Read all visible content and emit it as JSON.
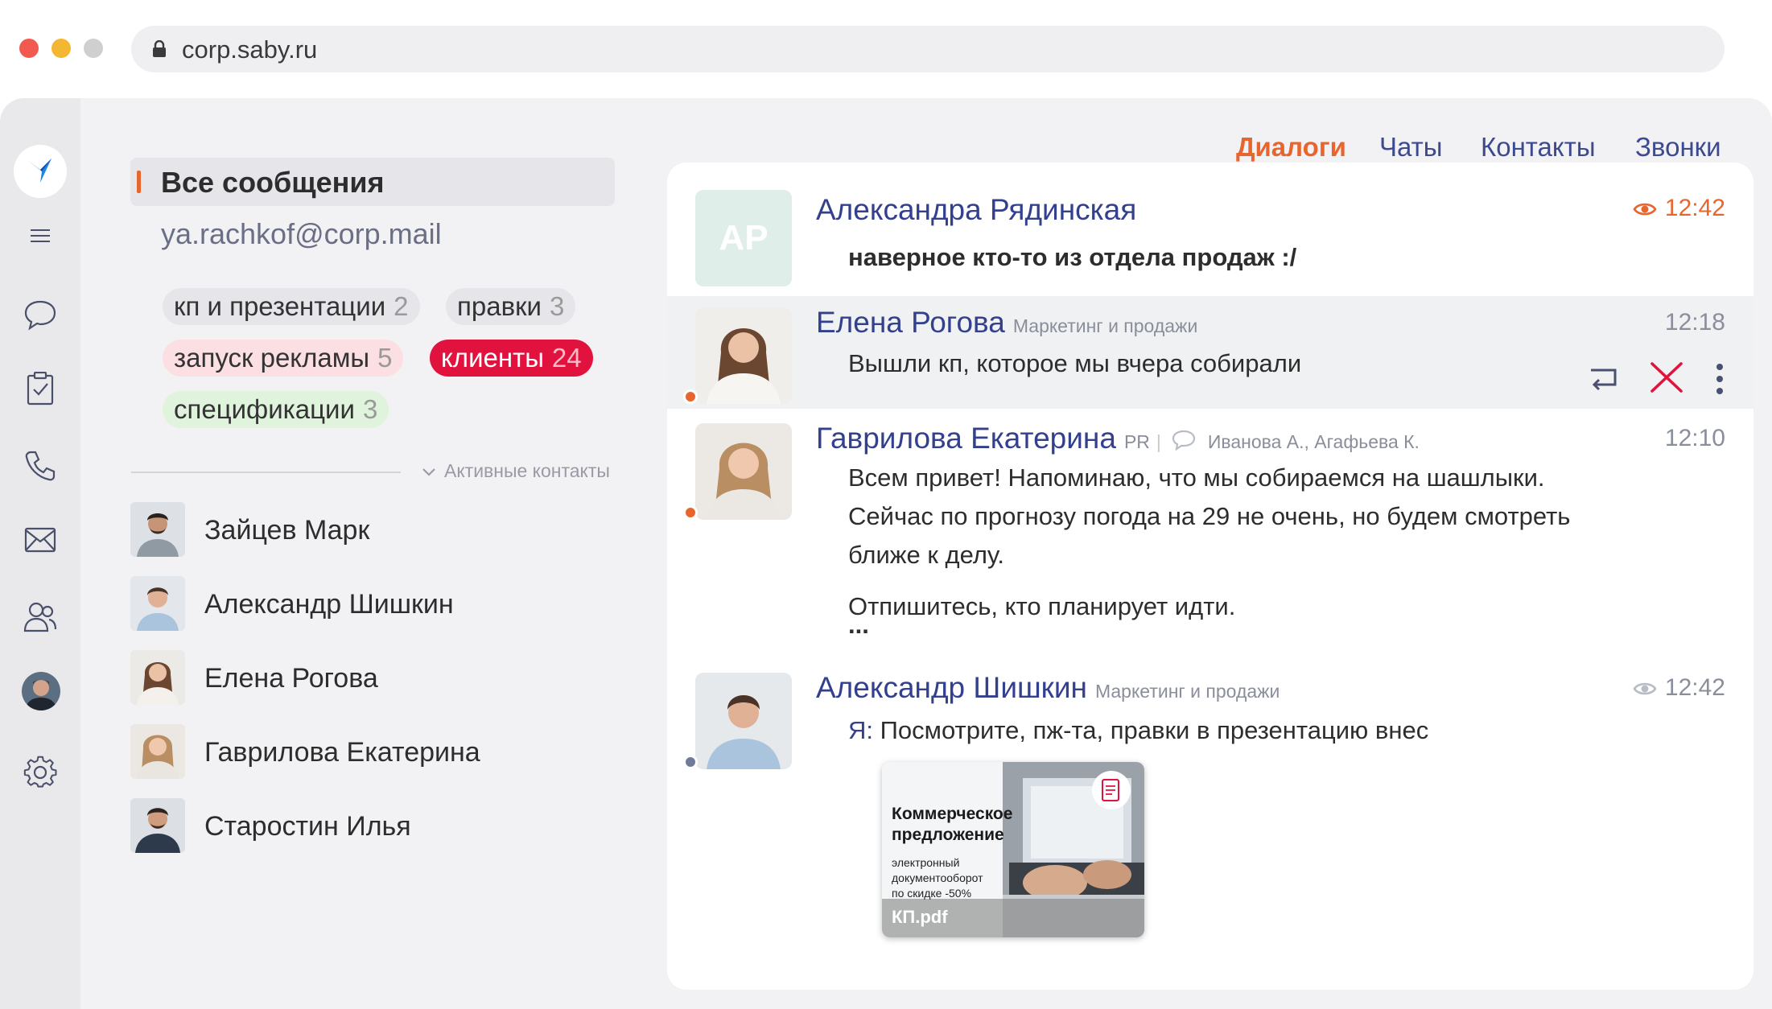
{
  "browser": {
    "url": "corp.saby.ru"
  },
  "rail": {
    "icons": [
      "logo-icon",
      "menu-icon",
      "chat-icon",
      "tasks-icon",
      "phone-icon",
      "mail-icon",
      "contacts-icon",
      "profile-avatar",
      "settings-icon"
    ]
  },
  "sidebar": {
    "all_messages": "Все сообщения",
    "account": "ya.rachkof@corp.mail",
    "folders": [
      {
        "label": "кп и презентации",
        "count": "2"
      },
      {
        "label": "правки",
        "count": "3"
      },
      {
        "label": "запуск рекламы",
        "count": "5"
      },
      {
        "label": "клиенты",
        "count": "24"
      },
      {
        "label": "спецификации",
        "count": "3"
      }
    ],
    "active_contacts_label": "Активные контакты",
    "contacts": [
      {
        "name": "Зайцев Марк"
      },
      {
        "name": "Александр Шишкин"
      },
      {
        "name": "Елена Рогова"
      },
      {
        "name": "Гаврилова Екатерина"
      },
      {
        "name": "Старостин Илья"
      }
    ]
  },
  "tabs": [
    {
      "label": "Диалоги",
      "active": true
    },
    {
      "label": "Чаты"
    },
    {
      "label": "Контакты"
    },
    {
      "label": "Звонки"
    }
  ],
  "messages": [
    {
      "initials": "АР",
      "sender": "Александра Рядинская",
      "time": "12:42",
      "text": "наверное кто-то из отдела продаж :/"
    },
    {
      "sender": "Елена Рогова",
      "dept": "Маркетинг и продажи",
      "time": "12:18",
      "text": "Вышли кп, которое мы вчера собирали"
    },
    {
      "sender": "Гаврилова Екатерина",
      "dept": "PR",
      "recipients": "Иванова А., Агафьева К.",
      "time": "12:10",
      "lines": [
        "Всем привет! Напоминаю, что мы собираемся на шашлыки.",
        "Сейчас по прогнозу погода на 29 не очень, но будем смотреть",
        "ближе к делу."
      ],
      "line4": "Отпишитесь, кто планирует идти.",
      "more": "..."
    },
    {
      "sender": "Александр Шишкин",
      "dept": "Маркетинг и продажи",
      "time": "12:42",
      "prefix": "Я:",
      "text": "Посмотрите, пж-та, правки в презентацию внес",
      "attachment": {
        "title1": "Коммерческое",
        "title2": "предложение",
        "sub1": "электронный",
        "sub2": "документооборот",
        "sub3": "по скидке -50%",
        "filename": "КП.pdf"
      }
    }
  ],
  "colors": {
    "accent": "#e8652e",
    "name_blue": "#33408e",
    "red_chip": "#e1133e"
  }
}
